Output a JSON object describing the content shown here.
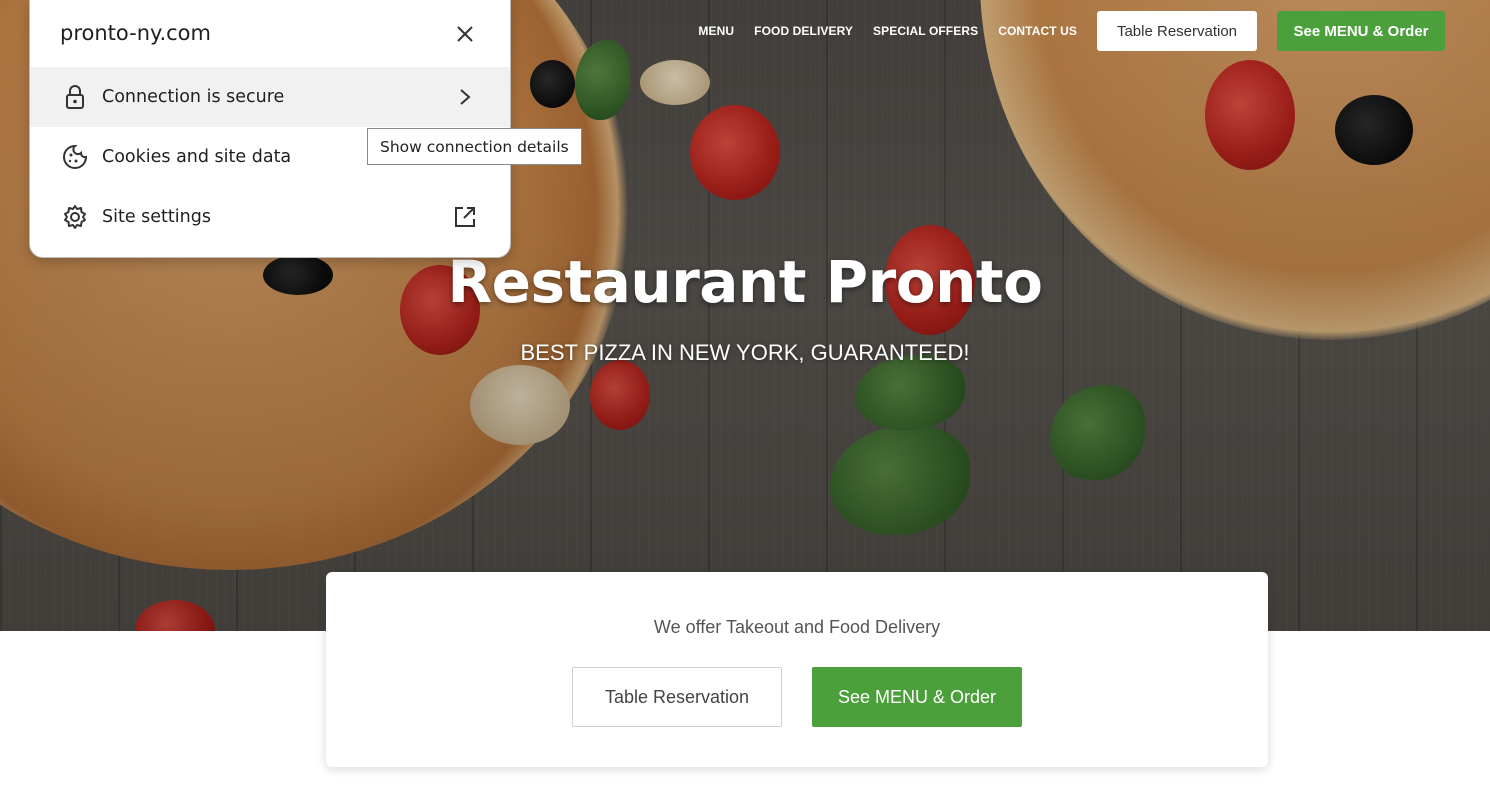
{
  "popup": {
    "domain": "pronto-ny.com",
    "close_icon": "close-icon",
    "rows": [
      {
        "label": "Connection is secure",
        "icon": "lock-icon",
        "end_icon": "chevron-right-icon"
      },
      {
        "label": "Cookies and site data",
        "icon": "cookie-icon"
      },
      {
        "label": "Site settings",
        "icon": "gear-icon",
        "end_icon": "external-link-icon"
      }
    ],
    "tooltip": "Show connection details"
  },
  "nav": {
    "links": [
      "MENU",
      "FOOD DELIVERY",
      "SPECIAL OFFERS",
      "CONTACT US"
    ],
    "reservation_label": "Table Reservation",
    "order_label": "See MENU & Order"
  },
  "hero": {
    "title": "Restaurant Pronto",
    "subtitle": "BEST PIZZA IN NEW YORK, GUARANTEED!"
  },
  "card": {
    "text": "We offer Takeout and Food Delivery",
    "reservation_label": "Table Reservation",
    "order_label": "See MENU & Order"
  },
  "colors": {
    "accent_green": "#4ba03b",
    "hero_wood": "#56524d",
    "popup_active_row": "#f1f1f1"
  }
}
